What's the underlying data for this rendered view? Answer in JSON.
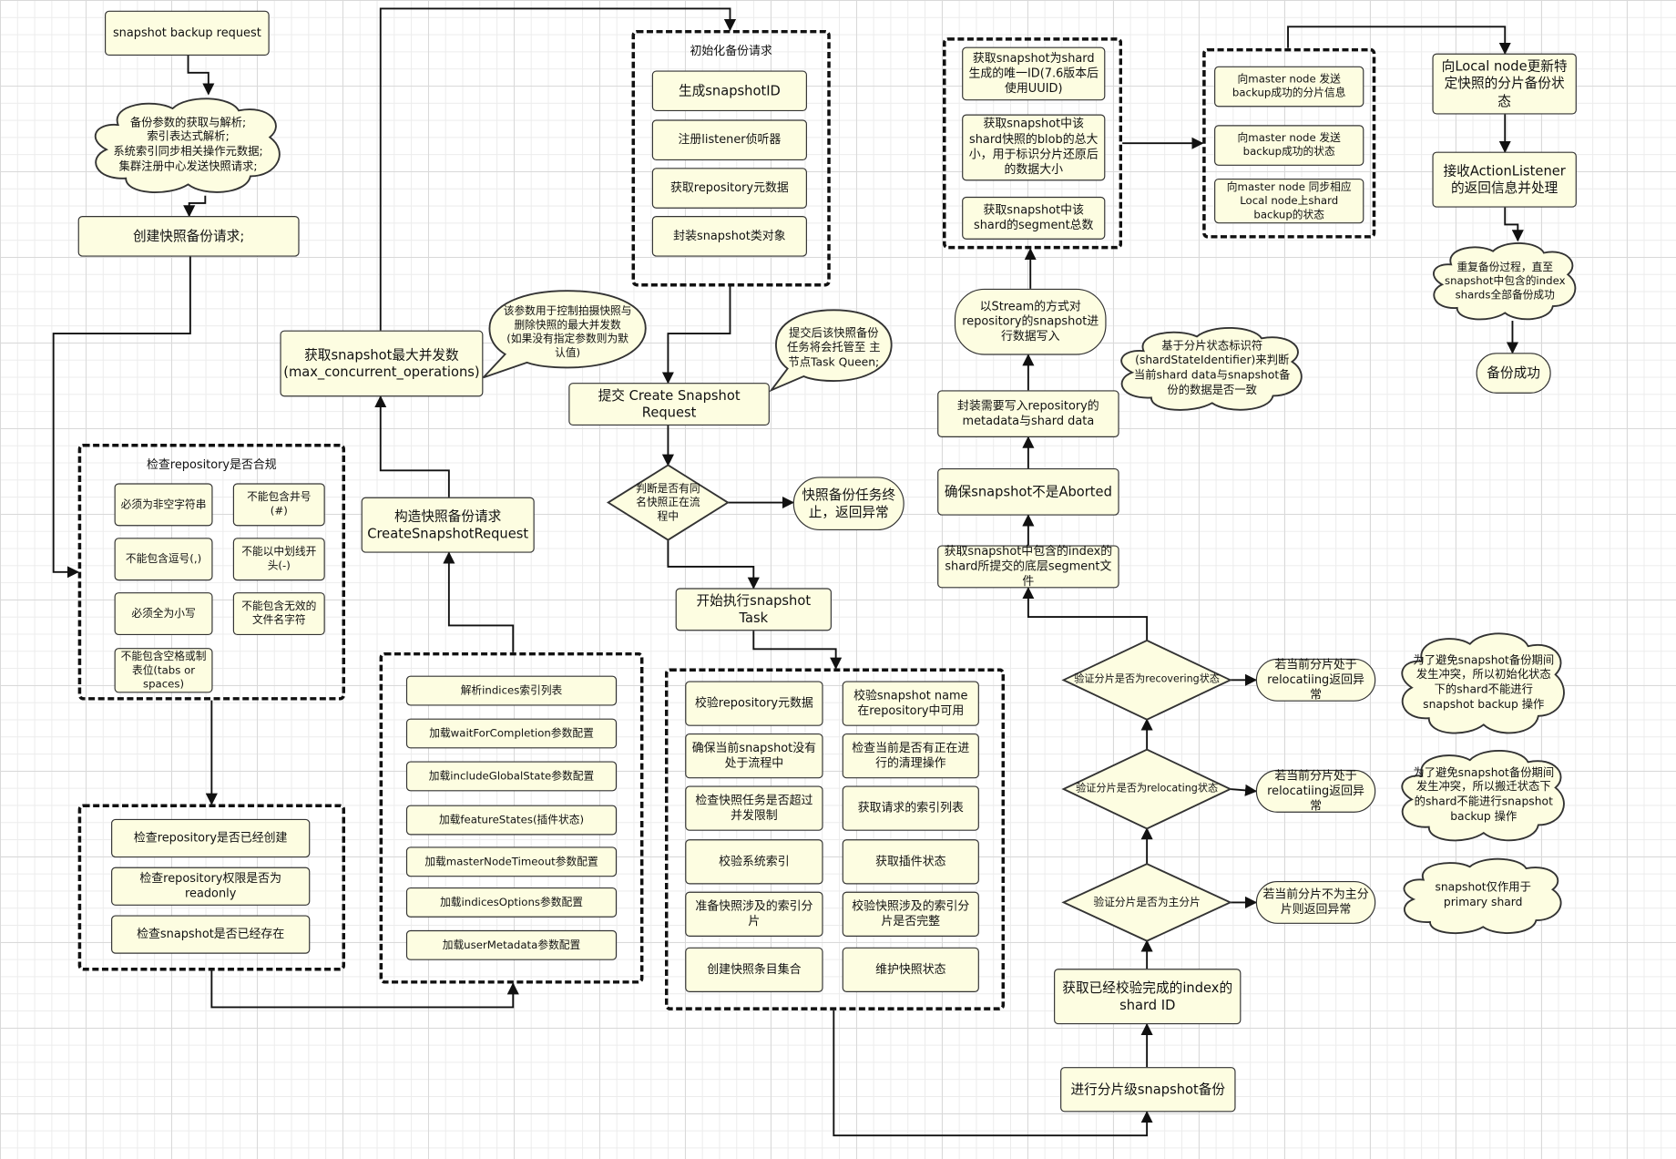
{
  "colors": {
    "node_fill": "#fdfde1",
    "stroke": "#333333",
    "grid": "#ececec"
  },
  "start": "snapshot backup request",
  "cloud_parse": "备份参数的获取与解析;\n索引表达式解析;\n系统索引同步相关操作元数据;\n集群注册中心发送快照请求;",
  "create_request": "创建快照备份请求;",
  "repo_check": {
    "title": "检查repository是否合规",
    "items": [
      "必须为非空字符串",
      "不能包含井号(#)",
      "不能包含逗号(,)",
      "不能以中划线开头(-)",
      "必须全为小写",
      "不能包含无效的文件名字符",
      "不能包含空格或制表位(tabs or spaces)"
    ]
  },
  "repo_exist": {
    "items": [
      "检查repository是否已经创建",
      "检查repository权限是否为readonly",
      "检查snapshot是否已经存在"
    ]
  },
  "params": {
    "items": [
      "解析indices索引列表",
      "加载waitForCompletion参数配置",
      "加载includeGlobalState参数配置",
      "加载featureStates(插件状态)",
      "加载masterNodeTimeout参数配置",
      "加载indicesOptions参数配置",
      "加载userMetadata参数配置"
    ]
  },
  "build_request": "构造快照备份请求\nCreateSnapshotRequest",
  "max_concurrent": "获取snapshot最大并发数\n(max_concurrent_operations)",
  "bubble_concurrent": "该参数用于控制拍摄快照与删除快照的最大并发数\n(如果没有指定参数则为默认值)",
  "init": {
    "title": "初始化备份请求",
    "items": [
      "生成snapshotID",
      "注册listener侦听器",
      "获取repository元数据",
      "封装snapshot类对象"
    ]
  },
  "submit": "提交 Create Snapshot Request",
  "bubble_submit": "提交后该快照备份任务将会托管至 主节点Task Queen;",
  "decision_same_name": "判断是否有同名快照正在流程中",
  "abort_terminal": "快照备份任务终止，返回异常",
  "start_task": "开始执行snapshot Task",
  "task": {
    "items": [
      "校验repository元数据",
      "校验snapshot name 在repository中可用",
      "确保当前snapshot没有处于流程中",
      "检查当前是否有正在进行的清理操作",
      "检查快照任务是否超过并发限制",
      "获取请求的索引列表",
      "校验系统索引",
      "获取插件状态",
      "准备快照涉及的索引分片",
      "校验快照涉及的索引分片是否完整",
      "创建快照条目集合",
      "维护快照状态"
    ]
  },
  "shard_backup": "进行分片级snapshot备份",
  "get_shard_id": "获取已经校验完成的index的shard ID",
  "decision_primary": "验证分片是否为主分片",
  "decision_relocating": "验证分片是否为relocating状态",
  "decision_recovering": "验证分片是否为recovering状态",
  "term_recovering": "若当前分片处于relocatiing返回异常",
  "term_relocating": "若当前分片处于relocatiing返回异常",
  "term_primary": "若当前分片不为主分片则返回异常",
  "cloud_recovering": "为了避免snapshot备份期间发生冲突，所以初始化状态下的shard不能进行snapshot backup 操作",
  "cloud_relocating": "为了避免snapshot备份期间发生冲突，所以搬迁状态下的shard不能进行snapshot backup 操作",
  "cloud_primary": "snapshot仅作用于primary shard",
  "segment_files": "获取snapshot中包含的index的shard所提交的底层segment文件",
  "not_aborted": "确保snapshot不是Aborted",
  "wrap_data": "封装需要写入repository的metadata与shard data",
  "stream_write": "以Stream的方式对repository的snapshot进行数据写入",
  "cloud_state_id": "基于分片状态标识符\n(shardStateIdentifier)来判断当前shard data与snapshot备份的数据是否一致",
  "shard_info": {
    "items": [
      "获取snapshot为shard生成的唯一ID(7.6版本后使用UUID)",
      "获取snapshot中该shard快照的blob的总大小，用于标识分片还原后的数据大小",
      "获取snapshot中该shard的segment总数"
    ]
  },
  "master": {
    "items": [
      "向master node 发送backup成功的分片信息",
      "向master node 发送backup成功的状态",
      "向master node 同步相应Local node上shard backup的状态"
    ]
  },
  "local_update": "向Local node更新特定快照的分片备份状态",
  "listener": "接收ActionListener的返回信息并处理",
  "cloud_repeat": "重复备份过程，直至snapshot中包含的index shards全部备份成功",
  "success": "备份成功"
}
